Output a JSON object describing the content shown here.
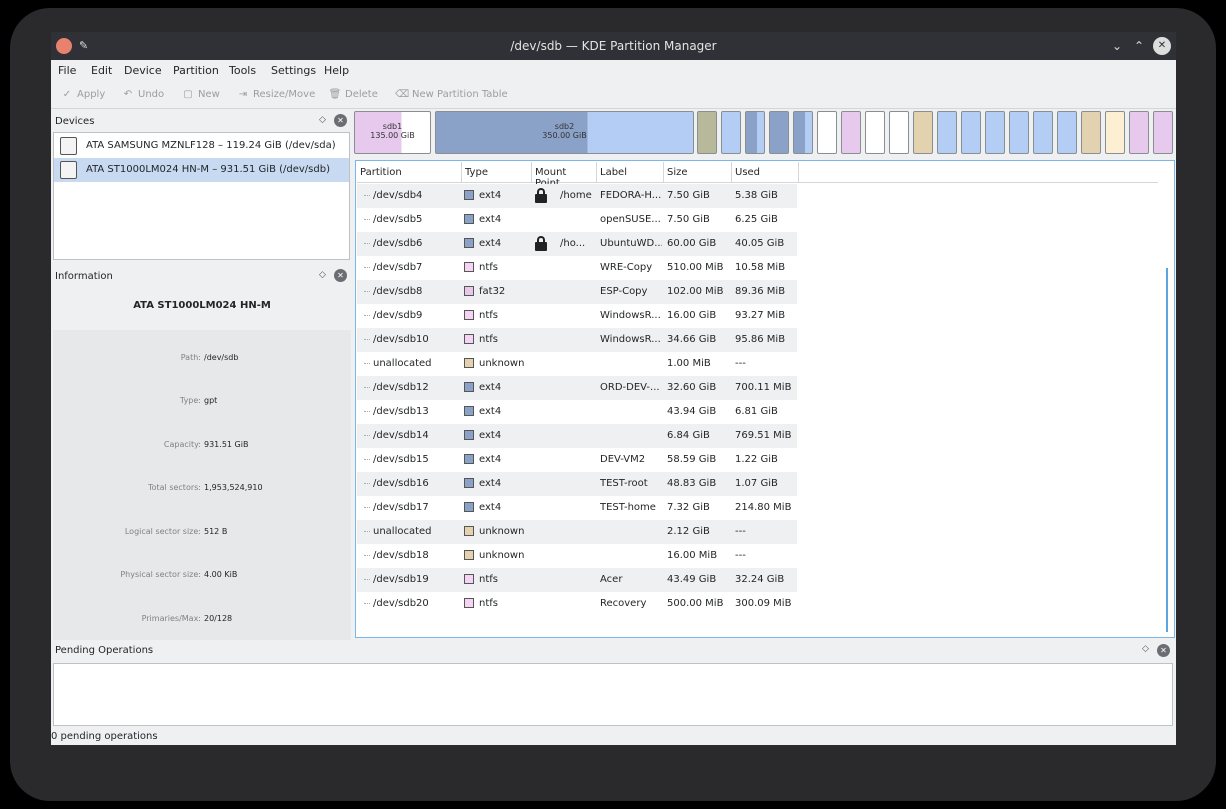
{
  "window": {
    "title": "/dev/sdb — KDE Partition Manager"
  },
  "menu": [
    "File",
    "Edit",
    "Device",
    "Partition",
    "Tools",
    "Settings",
    "Help"
  ],
  "toolbar": {
    "apply": "Apply",
    "undo": "Undo",
    "new": "New",
    "resize": "Resize/Move",
    "delete": "Delete",
    "new_table": "New Partition Table"
  },
  "devices": {
    "title": "Devices",
    "items": [
      {
        "label": "ATA SAMSUNG MZNLF128 – 119.24 GiB (/dev/sda)",
        "selected": false
      },
      {
        "label": "ATA ST1000LM024 HN-M – 931.51 GiB (/dev/sdb)",
        "selected": true
      }
    ]
  },
  "information": {
    "title": "Information",
    "device_name": "ATA ST1000LM024 HN-M",
    "rows": [
      {
        "key": "Path:",
        "value": "/dev/sdb"
      },
      {
        "key": "Type:",
        "value": "gpt"
      },
      {
        "key": "Capacity:",
        "value": "931.51 GiB"
      },
      {
        "key": "Total sectors:",
        "value": "1,953,524,910"
      },
      {
        "key": "Logical sector size:",
        "value": "512 B"
      },
      {
        "key": "Physical sector size:",
        "value": "4.00 KiB"
      },
      {
        "key": "Primaries/Max:",
        "value": "20/128"
      }
    ]
  },
  "partition_bar": {
    "sdb1_name": "sdb1",
    "sdb1_size": "135.00 GiB",
    "sdb2_name": "sdb2",
    "sdb2_size": "350.00 GiB"
  },
  "colors": {
    "ext4": "#8aa2c8",
    "ntfs": "#f5d3f2",
    "fat32": "#e8c7e8",
    "unknown": "#e2d2b0",
    "selection": "#c7daf2",
    "focus": "#5da5e0"
  },
  "table": {
    "headers": [
      "Partition",
      "Type",
      "Mount Point",
      "Label",
      "Size",
      "Used"
    ],
    "rows": [
      {
        "partition": "/dev/sdb4",
        "type": "ext4",
        "mount": "/home",
        "locked": true,
        "label": "FEDORA-H...",
        "size": "7.50 GiB",
        "used": "5.38 GiB"
      },
      {
        "partition": "/dev/sdb5",
        "type": "ext4",
        "mount": "",
        "locked": false,
        "label": "openSUSE...",
        "size": "7.50 GiB",
        "used": "6.25 GiB"
      },
      {
        "partition": "/dev/sdb6",
        "type": "ext4",
        "mount": "/ho...",
        "locked": true,
        "label": "UbuntuWD...",
        "size": "60.00 GiB",
        "used": "40.05 GiB"
      },
      {
        "partition": "/dev/sdb7",
        "type": "ntfs",
        "mount": "",
        "locked": false,
        "label": "WRE-Copy",
        "size": "510.00 MiB",
        "used": "10.58 MiB"
      },
      {
        "partition": "/dev/sdb8",
        "type": "fat32",
        "mount": "",
        "locked": false,
        "label": "ESP-Copy",
        "size": "102.00 MiB",
        "used": "89.36 MiB"
      },
      {
        "partition": "/dev/sdb9",
        "type": "ntfs",
        "mount": "",
        "locked": false,
        "label": "WindowsR...",
        "size": "16.00 GiB",
        "used": "93.27 MiB"
      },
      {
        "partition": "/dev/sdb10",
        "type": "ntfs",
        "mount": "",
        "locked": false,
        "label": "WindowsR...",
        "size": "34.66 GiB",
        "used": "95.86 MiB"
      },
      {
        "partition": "unallocated",
        "type": "unknown",
        "mount": "",
        "locked": false,
        "label": "",
        "size": "1.00 MiB",
        "used": "---"
      },
      {
        "partition": "/dev/sdb12",
        "type": "ext4",
        "mount": "",
        "locked": false,
        "label": "ORD-DEV-...",
        "size": "32.60 GiB",
        "used": "700.11 MiB"
      },
      {
        "partition": "/dev/sdb13",
        "type": "ext4",
        "mount": "",
        "locked": false,
        "label": "",
        "size": "43.94 GiB",
        "used": "6.81 GiB"
      },
      {
        "partition": "/dev/sdb14",
        "type": "ext4",
        "mount": "",
        "locked": false,
        "label": "",
        "size": "6.84 GiB",
        "used": "769.51 MiB"
      },
      {
        "partition": "/dev/sdb15",
        "type": "ext4",
        "mount": "",
        "locked": false,
        "label": "DEV-VM2",
        "size": "58.59 GiB",
        "used": "1.22 GiB"
      },
      {
        "partition": "/dev/sdb16",
        "type": "ext4",
        "mount": "",
        "locked": false,
        "label": "TEST-root",
        "size": "48.83 GiB",
        "used": "1.07 GiB"
      },
      {
        "partition": "/dev/sdb17",
        "type": "ext4",
        "mount": "",
        "locked": false,
        "label": "TEST-home",
        "size": "7.32 GiB",
        "used": "214.80 MiB"
      },
      {
        "partition": "unallocated",
        "type": "unknown",
        "mount": "",
        "locked": false,
        "label": "",
        "size": "2.12 GiB",
        "used": "---"
      },
      {
        "partition": "/dev/sdb18",
        "type": "unknown",
        "mount": "",
        "locked": false,
        "label": "",
        "size": "16.00 MiB",
        "used": "---"
      },
      {
        "partition": "/dev/sdb19",
        "type": "ntfs",
        "mount": "",
        "locked": false,
        "label": "Acer",
        "size": "43.49 GiB",
        "used": "32.24 GiB"
      },
      {
        "partition": "/dev/sdb20",
        "type": "ntfs",
        "mount": "",
        "locked": false,
        "label": "Recovery",
        "size": "500.00 MiB",
        "used": "300.09 MiB"
      }
    ]
  },
  "pending": {
    "title": "Pending Operations"
  },
  "status": {
    "text": "0 pending operations"
  }
}
